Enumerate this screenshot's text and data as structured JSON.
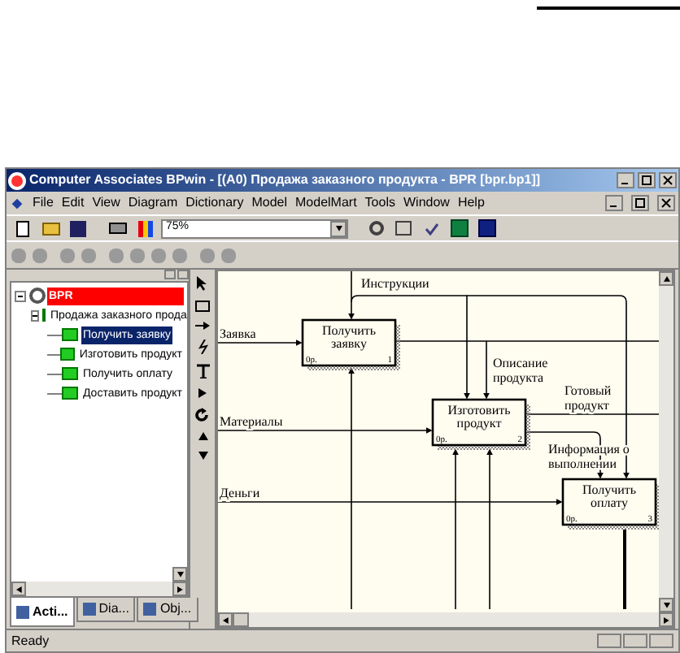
{
  "window": {
    "title": "Computer Associates BPwin - [(A0) Продажа заказного продукта - BPR  [bpr.bp1]]"
  },
  "menu": [
    "File",
    "Edit",
    "View",
    "Diagram",
    "Dictionary",
    "Model",
    "ModelMart",
    "Tools",
    "Window",
    "Help"
  ],
  "zoom": {
    "value": "75%"
  },
  "tree": {
    "label": "BPR",
    "selected": false,
    "expanded": true,
    "children": [
      {
        "label": "Продажа заказного прода",
        "selected": false,
        "expanded": true,
        "children": [
          {
            "label": "Получить заявку",
            "selected": true
          },
          {
            "label": "Изготовить продукт",
            "selected": false
          },
          {
            "label": "Получить оплату",
            "selected": false
          },
          {
            "label": "Доставить продукт",
            "selected": false
          }
        ]
      }
    ]
  },
  "panel_tabs": [
    {
      "label": "Acti...",
      "selected": true
    },
    {
      "label": "Dia...",
      "selected": false
    },
    {
      "label": "Obj...",
      "selected": false
    }
  ],
  "diagram": {
    "boxes": [
      {
        "title": [
          "Получить",
          "заявку"
        ],
        "cost": "0р.",
        "number": "1"
      },
      {
        "title": [
          "Изготовить",
          "продукт"
        ],
        "cost": "0р.",
        "number": "2"
      },
      {
        "title": [
          "Получить",
          "оплату"
        ],
        "cost": "0р.",
        "number": "3"
      }
    ],
    "arrows": [
      {
        "label": [
          "Заявка"
        ]
      },
      {
        "label": [
          "Инструкции"
        ]
      },
      {
        "label": [
          "Описание",
          "продукта"
        ]
      },
      {
        "label": [
          "Материалы"
        ]
      },
      {
        "label": [
          "Готовый",
          "продукт"
        ]
      },
      {
        "label": [
          "Информация о",
          "выполнении"
        ]
      },
      {
        "label": [
          "Деньги"
        ]
      }
    ]
  },
  "status_bar": {
    "text": "Ready"
  }
}
